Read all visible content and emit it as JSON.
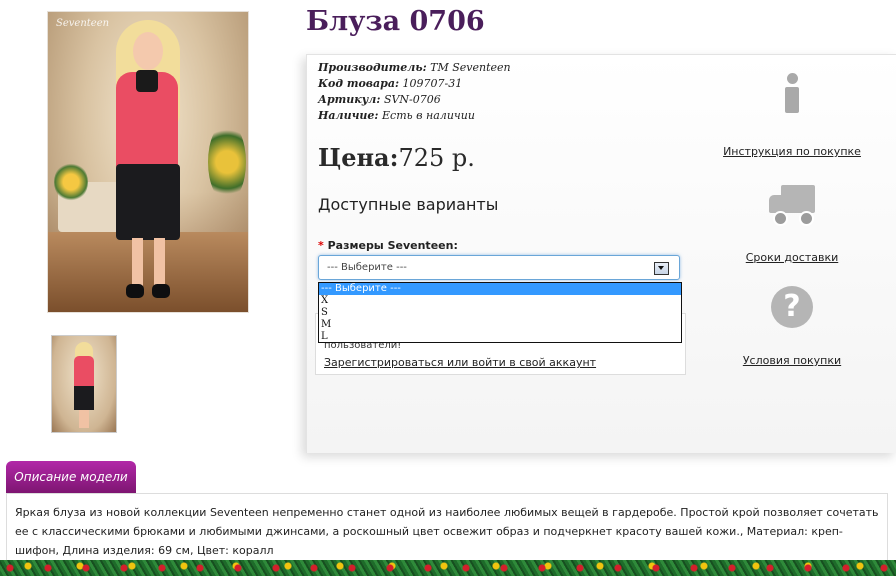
{
  "product": {
    "title": "Блуза 0706",
    "photo_watermark": "Seventeen",
    "specs": [
      {
        "label": "Производитель:",
        "value": "ТМ Seventeen"
      },
      {
        "label": "Код товара:",
        "value": "109707-31"
      },
      {
        "label": "Артикул:",
        "value": "SVN-0706"
      },
      {
        "label": "Наличие:",
        "value": "Есть в наличии"
      }
    ],
    "price_label": "Цена:",
    "price_value": "725 р.",
    "variants_title": "Доступные варианты",
    "size_required_mark": "*",
    "size_label": "Размеры Seventeen:",
    "size_select_value": "--- Выберите ---",
    "size_options": [
      "--- Выберите ---",
      "X",
      "S",
      "M",
      "L"
    ],
    "login_text": "пользователи!",
    "login_link": "Зарегистрироваться или войти в свой аккаунт"
  },
  "sidebar_links": {
    "instructions": "Инструкция по покупке",
    "delivery": "Сроки доставки",
    "terms": "Условия покупки"
  },
  "description": {
    "tab_label": "Описание модели",
    "text": "Яркая блуза из новой коллекции Seventeen непременно станет одной из наиболее любимых вещей в гардеробе. Простой крой позволяет сочетать ее с классическими брюками и любимыми джинсами, а роскошный цвет освежит образ и подчеркнет красоту вашей кожи., Материал: креп-шифон, Длина изделия: 69 см, Цвет: коралл"
  },
  "icons": {
    "info": "info-icon",
    "delivery": "truck-icon",
    "help": "question-icon",
    "dropdown": "chevron-down-icon"
  },
  "colors": {
    "title": "#4a1e5b",
    "tab_purple": "#9b1f8f",
    "select_highlight": "#3399ff"
  }
}
